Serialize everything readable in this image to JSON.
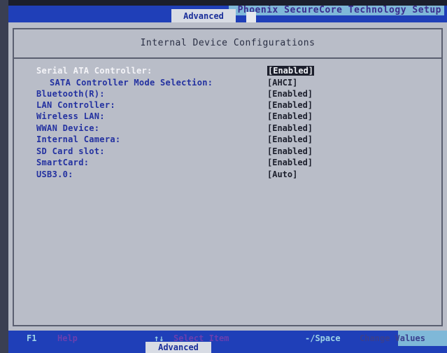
{
  "header": {
    "title": "Phoenix SecureCore Technology Setup",
    "active_tab": "Advanced"
  },
  "panel": {
    "title": "Internal Device Configurations"
  },
  "settings": [
    {
      "label": "Serial ATA Controller:",
      "value": "[Enabled]",
      "selected": true
    },
    {
      "label": "SATA Controller Mode Selection:",
      "value": "[AHCI]"
    },
    {
      "label": "Bluetooth(R):",
      "value": "[Enabled]"
    },
    {
      "label": "LAN Controller:",
      "value": "[Enabled]"
    },
    {
      "label": "Wireless LAN:",
      "value": "[Enabled]"
    },
    {
      "label": "WWAN Device:",
      "value": "[Enabled]"
    },
    {
      "label": "Internal Camera:",
      "value": "[Enabled]"
    },
    {
      "label": "SD Card slot:",
      "value": "[Enabled]"
    },
    {
      "label": "SmartCard:",
      "value": "[Enabled]"
    },
    {
      "label": "USB3.0:",
      "value": "[Auto]"
    }
  ],
  "footer": {
    "f1_key": "F1",
    "f1_desc": "Help",
    "arrows_key": "↑↓",
    "arrows_desc": "Select Item",
    "space_key": "-/Space",
    "space_desc": "Change Values",
    "bottom_tab": "Advanced"
  },
  "colors": {
    "bar_blue": "#1f3fb8",
    "panel_gray": "#b9bdc8",
    "label_blue": "#2331a0"
  }
}
